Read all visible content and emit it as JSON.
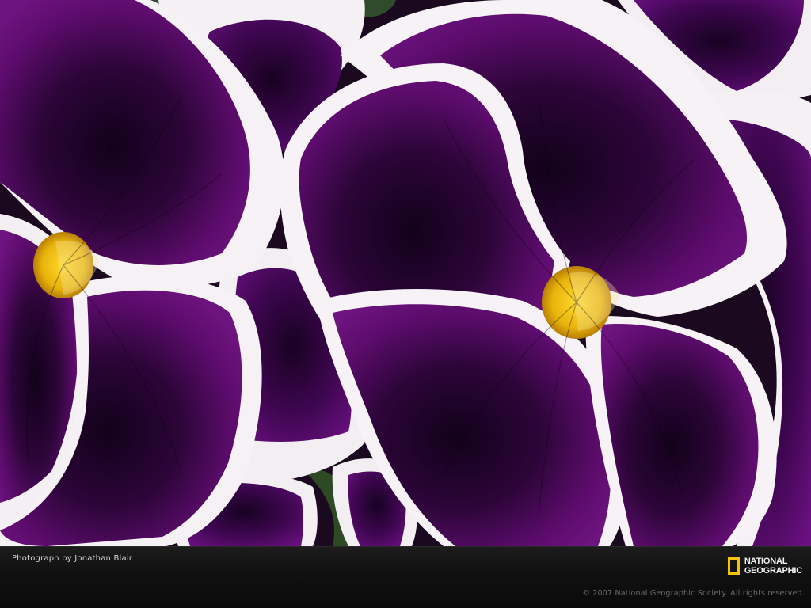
{
  "photo": {
    "subject": "purple-and-white-pansies"
  },
  "caption": {
    "credit": "Photograph by Jonathan Blair",
    "copyright": "© 2007 National Geographic Society. All rights reserved."
  },
  "logo": {
    "line1": "NATIONAL",
    "line2": "GEOGRAPHIC",
    "frame_color": "#f5c400"
  },
  "colors": {
    "petal_dark": "#1e0328",
    "petal_mid": "#5a0a6a",
    "petal_rim": "#f6f2f4",
    "eye_yellow": "#f1c40f"
  }
}
